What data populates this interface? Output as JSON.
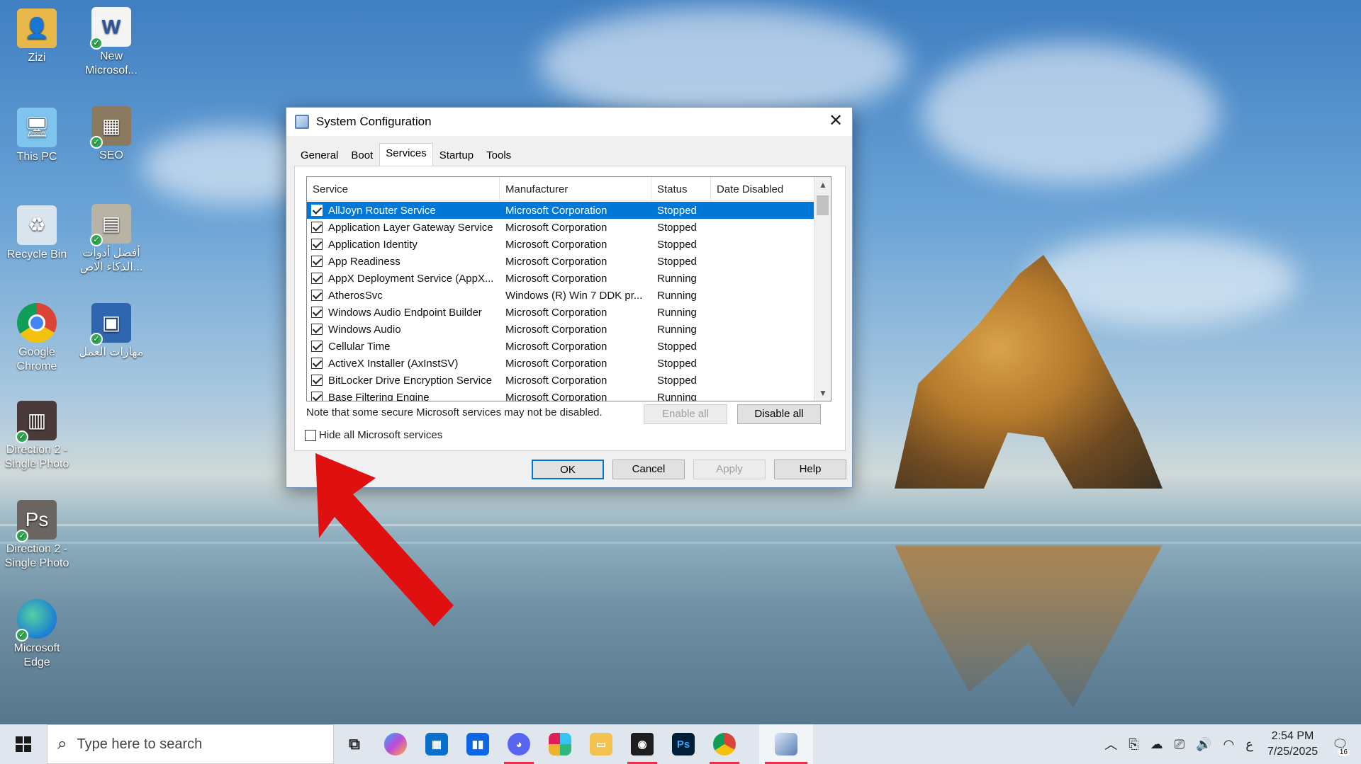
{
  "desktop": {
    "icons": [
      {
        "label": "Zizi"
      },
      {
        "label": "New Microsof..."
      },
      {
        "label": "This PC"
      },
      {
        "label": "SEO"
      },
      {
        "label": "Recycle Bin"
      },
      {
        "label": "أفضل أدوات الذكاء الاص..."
      },
      {
        "label": "Google Chrome"
      },
      {
        "label": "مهارات العمل"
      },
      {
        "label": "Direction 2 - Single Photo"
      },
      {
        "label": "Direction 2 - Single Photo"
      },
      {
        "label": "Microsoft Edge"
      }
    ]
  },
  "dialog": {
    "title": "System Configuration",
    "tabs": [
      "General",
      "Boot",
      "Services",
      "Startup",
      "Tools"
    ],
    "active_tab": "Services",
    "columns": [
      "Service",
      "Manufacturer",
      "Status",
      "Date Disabled"
    ],
    "rows": [
      {
        "service": "AllJoyn Router Service",
        "manufacturer": "Microsoft Corporation",
        "status": "Stopped",
        "date": "",
        "checked": true,
        "selected": true
      },
      {
        "service": "Application Layer Gateway Service",
        "manufacturer": "Microsoft Corporation",
        "status": "Stopped",
        "date": "",
        "checked": true
      },
      {
        "service": "Application Identity",
        "manufacturer": "Microsoft Corporation",
        "status": "Stopped",
        "date": "",
        "checked": true
      },
      {
        "service": "App Readiness",
        "manufacturer": "Microsoft Corporation",
        "status": "Stopped",
        "date": "",
        "checked": true
      },
      {
        "service": "AppX Deployment Service (AppX...",
        "manufacturer": "Microsoft Corporation",
        "status": "Running",
        "date": "",
        "checked": true
      },
      {
        "service": "AtherosSvc",
        "manufacturer": "Windows (R) Win 7 DDK pr...",
        "status": "Running",
        "date": "",
        "checked": true
      },
      {
        "service": "Windows Audio Endpoint Builder",
        "manufacturer": "Microsoft Corporation",
        "status": "Running",
        "date": "",
        "checked": true
      },
      {
        "service": "Windows Audio",
        "manufacturer": "Microsoft Corporation",
        "status": "Running",
        "date": "",
        "checked": true
      },
      {
        "service": "Cellular Time",
        "manufacturer": "Microsoft Corporation",
        "status": "Stopped",
        "date": "",
        "checked": true
      },
      {
        "service": "ActiveX Installer (AxInstSV)",
        "manufacturer": "Microsoft Corporation",
        "status": "Stopped",
        "date": "",
        "checked": true
      },
      {
        "service": "BitLocker Drive Encryption Service",
        "manufacturer": "Microsoft Corporation",
        "status": "Stopped",
        "date": "",
        "checked": true
      },
      {
        "service": "Base Filtering Engine",
        "manufacturer": "Microsoft Corporation",
        "status": "Running",
        "date": "",
        "checked": true
      }
    ],
    "note": "Note that some secure Microsoft services may not be disabled.",
    "enable_all": "Enable all",
    "disable_all": "Disable all",
    "hide_ms_label": "Hide all Microsoft services",
    "hide_ms_checked": false,
    "ok": "OK",
    "cancel": "Cancel",
    "apply": "Apply",
    "help": "Help",
    "close_glyph": "✕"
  },
  "taskbar": {
    "search_placeholder": "Type here to search",
    "apps": [
      "task-view",
      "copilot",
      "microsoft-store",
      "trello",
      "discord",
      "slack",
      "file-explorer",
      "obs",
      "photoshop",
      "chrome",
      "system-configuration"
    ],
    "time": "2:54 PM",
    "date": "7/25/2025",
    "notification_count": "16",
    "input_indicator": "ع"
  },
  "colors": {
    "selection": "#0078d7",
    "annotation_arrow": "#e01010"
  }
}
